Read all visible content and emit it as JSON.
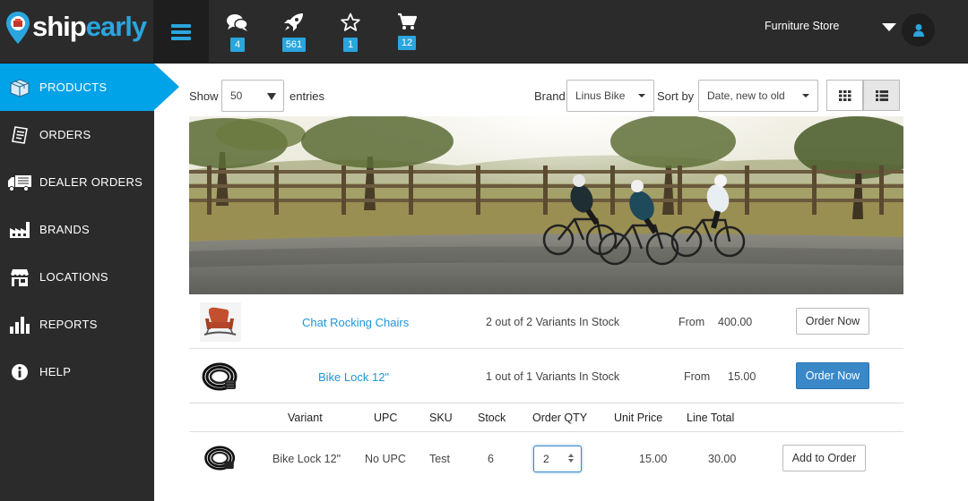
{
  "header": {
    "logo": {
      "ship": "ship",
      "early": "early"
    },
    "nav_icons": [
      {
        "name": "chat-icon",
        "badge": "4"
      },
      {
        "name": "rocket-icon",
        "badge": "561"
      },
      {
        "name": "star-icon",
        "badge": "1"
      },
      {
        "name": "cart-icon",
        "badge": "12"
      }
    ],
    "store_name": "Furniture Store"
  },
  "sidebar": {
    "items": [
      {
        "label": "PRODUCTS",
        "icon": "products-icon",
        "active": true
      },
      {
        "label": "ORDERS",
        "icon": "orders-icon"
      },
      {
        "label": "DEALER ORDERS",
        "icon": "truck-icon"
      },
      {
        "label": "BRANDS",
        "icon": "factory-icon"
      },
      {
        "label": "LOCATIONS",
        "icon": "store-icon"
      },
      {
        "label": "REPORTS",
        "icon": "bar-chart-icon"
      },
      {
        "label": "HELP",
        "icon": "info-icon"
      }
    ]
  },
  "toolbar": {
    "show_label": "Show",
    "entries_value": "50",
    "entries_label": "entries",
    "brand_label": "Brand",
    "brand_value": "Linus Bike",
    "sortby_label": "Sort by",
    "sortby_value": "Date, new to old"
  },
  "products": [
    {
      "name": "Chat Rocking Chairs",
      "stock": "2 out of 2 Variants In Stock",
      "from": "From",
      "price": "400.00",
      "button": "Order Now"
    },
    {
      "name": "Bike Lock 12\"",
      "stock": "1 out of 1 Variants In Stock",
      "from": "From",
      "price": "15.00",
      "button": "Order Now"
    }
  ],
  "variants": {
    "headers": [
      "Variant",
      "UPC",
      "SKU",
      "Stock",
      "Order QTY",
      "Unit Price",
      "Line Total"
    ],
    "rows": [
      {
        "variant": "Bike Lock 12\"",
        "upc": "No UPC",
        "sku": "Test",
        "stock": "6",
        "qty": "2",
        "unit_price": "15.00",
        "line_total": "30.00",
        "button": "Add to Order"
      }
    ]
  },
  "colors": {
    "accent": "#00a2e8",
    "header_bg": "#2b2b2b",
    "link": "#1e96d6",
    "primary_button": "#3a88c8"
  }
}
